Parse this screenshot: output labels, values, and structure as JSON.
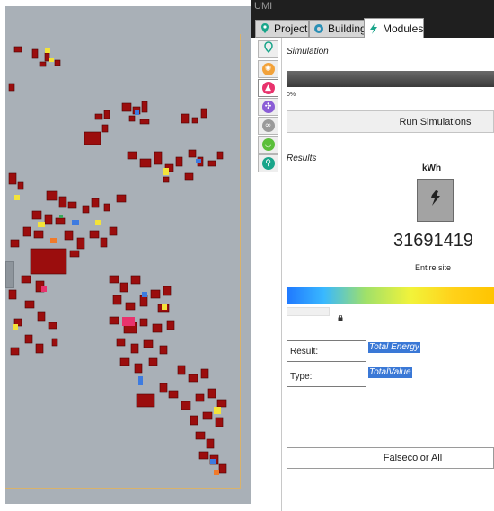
{
  "window": {
    "title": "UMI"
  },
  "tabs": [
    {
      "label": "Project",
      "icon": "map-pin-icon"
    },
    {
      "label": "Building",
      "icon": "gear-icon"
    },
    {
      "label": "Modules",
      "icon": "lightning-icon",
      "active": true
    }
  ],
  "sidebar": {
    "items": [
      {
        "icon": "location-pin-icon",
        "color": "#19a58a"
      },
      {
        "icon": "sun-icon",
        "color": "#f2a23a"
      },
      {
        "icon": "energy-flame-icon",
        "color": "#e8336d",
        "active": true
      },
      {
        "icon": "network-icon",
        "color": "#8a5cd6"
      },
      {
        "icon": "infinity-icon",
        "color": "#9a9a9a"
      },
      {
        "icon": "food-basket-icon",
        "color": "#5bbf3a"
      },
      {
        "icon": "walking-icon",
        "color": "#19a58a"
      }
    ]
  },
  "simulation": {
    "label": "Simulation",
    "progress_text": "0%",
    "progress": 0,
    "run_button": "Run Simulations"
  },
  "results": {
    "label": "Results",
    "unit": "kWh",
    "icon": "energy-lightning-icon",
    "total_value": "31691419",
    "scope": "Entire site",
    "legend_colors": [
      "#1f78ff",
      "#39b8ff",
      "#9fe06a",
      "#f2f33a",
      "#ffd21a",
      "#ffc400"
    ],
    "result_label": "Result:",
    "result_value": "Total Energy",
    "type_label": "Type:",
    "type_value": "TotalValue",
    "falsecolor_button": "Falsecolor All"
  },
  "viewport": {
    "background": "#a9b0b7",
    "building_color": "#9b0d0d"
  }
}
